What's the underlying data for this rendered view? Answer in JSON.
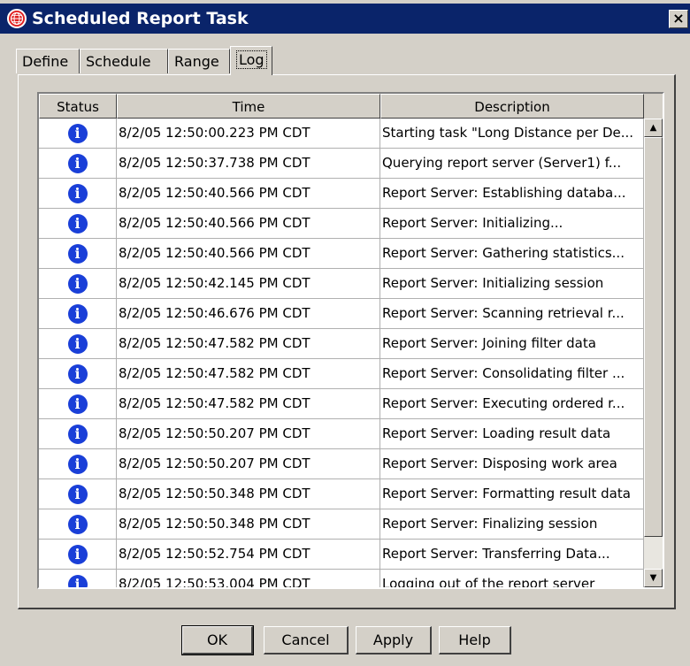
{
  "window": {
    "title": "Scheduled Report Task",
    "close_label": "×"
  },
  "tabs": [
    {
      "label": "Define",
      "active": false
    },
    {
      "label": "Schedule",
      "active": false
    },
    {
      "label": "Range",
      "active": false
    },
    {
      "label": "Log",
      "active": true
    }
  ],
  "table": {
    "columns": [
      "Status",
      "Time",
      "Description"
    ],
    "rows": [
      {
        "status": "info-icon",
        "time": "8/2/05 12:50:00.223 PM CDT",
        "description": "Starting task \"Long Distance per De..."
      },
      {
        "status": "info-icon",
        "time": "8/2/05 12:50:37.738 PM CDT",
        "description": "Querying report server (Server1) f..."
      },
      {
        "status": "info-icon",
        "time": "8/2/05 12:50:40.566 PM CDT",
        "description": "Report Server: Establishing databa..."
      },
      {
        "status": "info-icon",
        "time": "8/2/05 12:50:40.566 PM CDT",
        "description": "Report Server: Initializing..."
      },
      {
        "status": "info-icon",
        "time": "8/2/05 12:50:40.566 PM CDT",
        "description": "Report Server: Gathering statistics..."
      },
      {
        "status": "info-icon",
        "time": "8/2/05 12:50:42.145 PM CDT",
        "description": "Report Server: Initializing session"
      },
      {
        "status": "info-icon",
        "time": "8/2/05 12:50:46.676 PM CDT",
        "description": "Report Server: Scanning retrieval r..."
      },
      {
        "status": "info-icon",
        "time": "8/2/05 12:50:47.582 PM CDT",
        "description": "Report Server: Joining filter data"
      },
      {
        "status": "info-icon",
        "time": "8/2/05 12:50:47.582 PM CDT",
        "description": "Report Server: Consolidating filter ..."
      },
      {
        "status": "info-icon",
        "time": "8/2/05 12:50:47.582 PM CDT",
        "description": "Report Server: Executing ordered r..."
      },
      {
        "status": "info-icon",
        "time": "8/2/05 12:50:50.207 PM CDT",
        "description": "Report Server: Loading result data"
      },
      {
        "status": "info-icon",
        "time": "8/2/05 12:50:50.207 PM CDT",
        "description": "Report Server: Disposing work area"
      },
      {
        "status": "info-icon",
        "time": "8/2/05 12:50:50.348 PM CDT",
        "description": "Report Server: Formatting result data"
      },
      {
        "status": "info-icon",
        "time": "8/2/05 12:50:50.348 PM CDT",
        "description": "Report Server: Finalizing session"
      },
      {
        "status": "info-icon",
        "time": "8/2/05 12:50:52.754 PM CDT",
        "description": "Report Server: Transferring Data..."
      },
      {
        "status": "info-icon",
        "time": "8/2/05 12:50:53.004 PM CDT",
        "description": "Logging out of the report server"
      }
    ]
  },
  "buttons": {
    "ok": "OK",
    "cancel": "Cancel",
    "apply": "Apply",
    "help": "Help"
  },
  "colors": {
    "titlebar": "#0a246a",
    "face": "#d4d0c8",
    "info_icon": "#1a3fd8",
    "app_icon": "#e02020"
  }
}
